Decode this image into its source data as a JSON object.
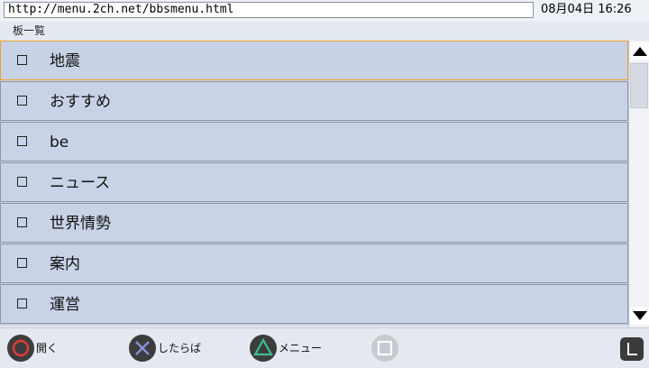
{
  "address_bar": {
    "url": "http://menu.2ch.net/bbsmenu.html"
  },
  "clock": {
    "text": "08月04日 16:26"
  },
  "section": {
    "title": "板一覧"
  },
  "list": {
    "items": [
      {
        "label": "地震",
        "selected": true
      },
      {
        "label": "おすすめ",
        "selected": false
      },
      {
        "label": "be",
        "selected": false
      },
      {
        "label": "ニュース",
        "selected": false
      },
      {
        "label": "世界情勢",
        "selected": false
      },
      {
        "label": "案内",
        "selected": false
      },
      {
        "label": "運営",
        "selected": false
      }
    ]
  },
  "bottom_bar": {
    "hints": [
      {
        "button": "circle",
        "label": "開く",
        "color": "#e03a3a"
      },
      {
        "button": "cross",
        "label": "したらば",
        "color": "#8a8fd8"
      },
      {
        "button": "triangle",
        "label": "メニュー",
        "color": "#3bbf8a"
      },
      {
        "button": "square",
        "label": "",
        "color": "#ffffff"
      }
    ],
    "l_button": "L"
  }
}
